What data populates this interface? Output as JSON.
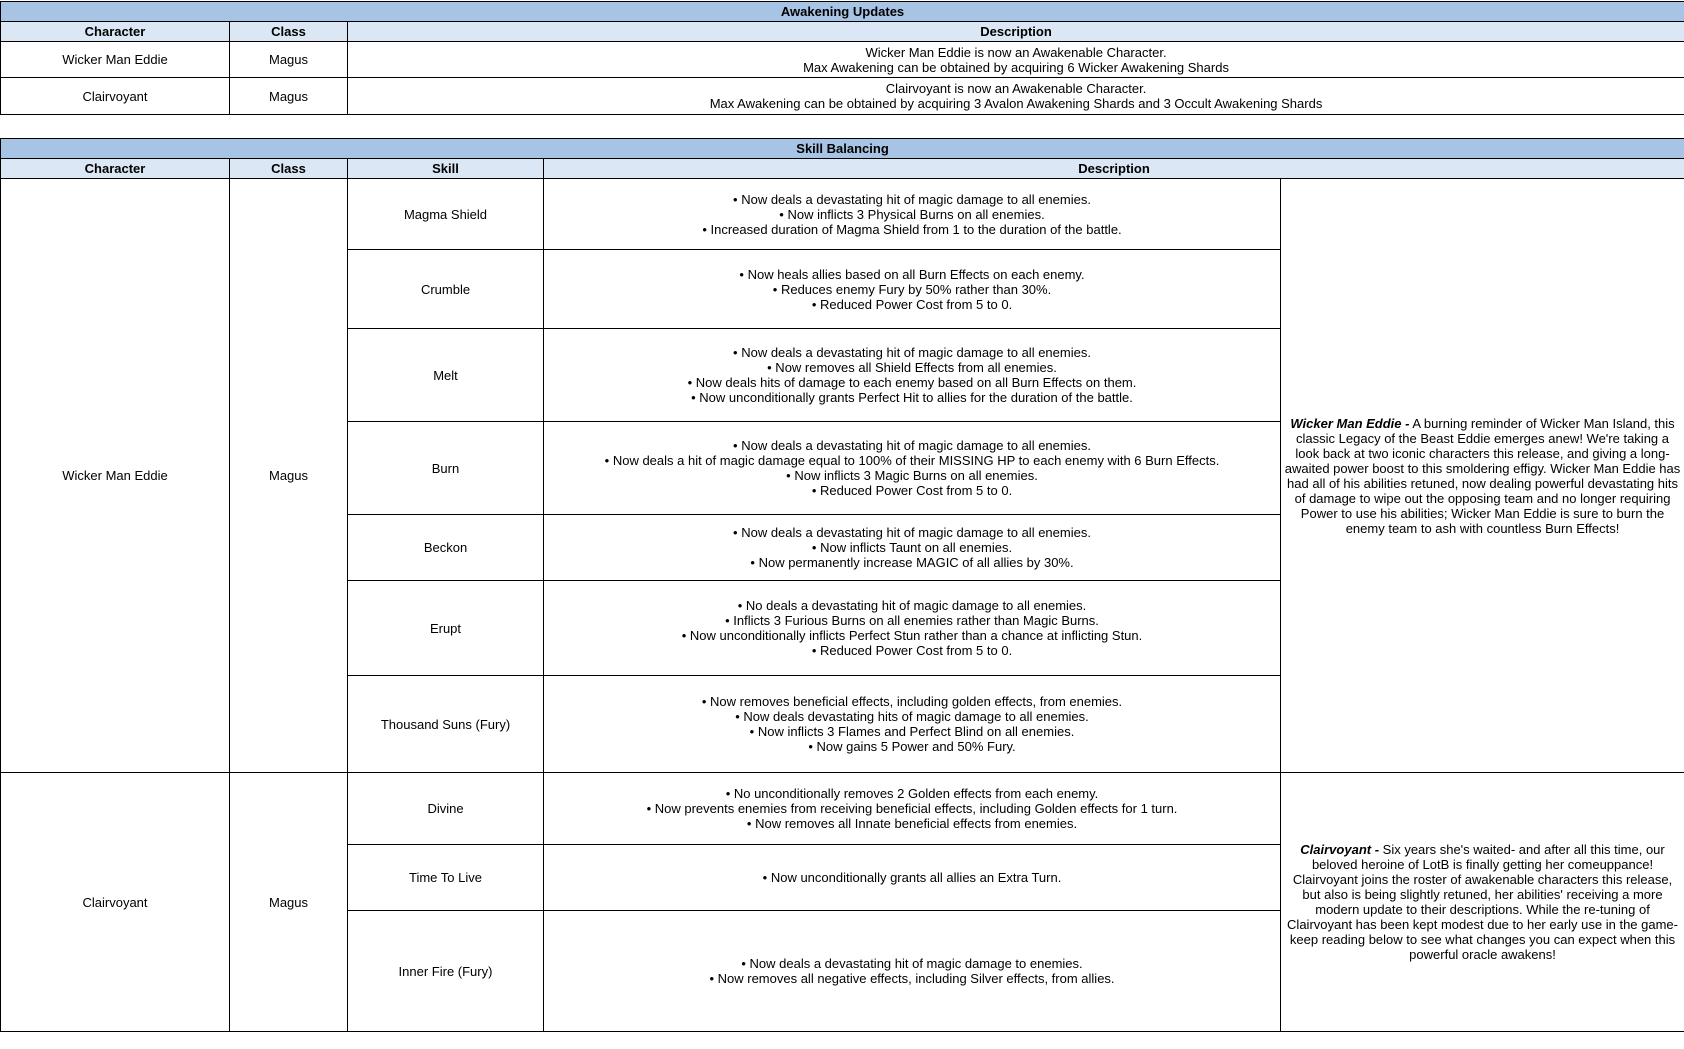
{
  "awakening": {
    "title": "Awakening Updates",
    "headers": [
      "Character",
      "Class",
      "Description"
    ],
    "rows": [
      {
        "character": "Wicker Man Eddie",
        "class": "Magus",
        "desc": [
          "Wicker Man Eddie is now an Awakenable Character.",
          "Max Awakening can be obtained by acquiring 6 Wicker Awakening Shards"
        ]
      },
      {
        "character": "Clairvoyant",
        "class": "Magus",
        "desc": [
          "Clairvoyant is now an Awakenable Character.",
          "Max Awakening can be obtained by acquiring 3 Avalon Awakening Shards and 3 Occult Awakening Shards"
        ]
      }
    ]
  },
  "balancing": {
    "title": "Skill Balancing",
    "headers": [
      "Character",
      "Class",
      "Skill",
      "Description"
    ],
    "groups": [
      {
        "character": "Wicker Man Eddie",
        "class": "Magus",
        "lore_name": "Wicker Man Eddie -",
        "lore_text": " A burning reminder of Wicker Man Island, this classic Legacy of the Beast Eddie emerges anew! We're taking a look back at two iconic characters this release, and giving a long-awaited power boost to this smoldering effigy. Wicker Man Eddie has had all of his abilities retuned, now dealing powerful devastating hits of damage to wipe out the opposing team and no longer requiring Power to use his abilities; Wicker Man Eddie is sure to burn the enemy team to ash with countless Burn Effects!",
        "skills": [
          {
            "name": "Magma Shield",
            "desc": [
              "• Now deals a devastating hit of magic damage to all enemies.",
              "• Now inflicts 3 Physical Burns on all enemies.",
              "• Increased duration of Magma Shield from 1 to the duration of the battle."
            ]
          },
          {
            "name": "Crumble",
            "desc": [
              "• Now heals allies based on all Burn Effects on each enemy.",
              "• Reduces enemy Fury by 50% rather than 30%.",
              "• Reduced Power Cost from 5 to 0."
            ]
          },
          {
            "name": "Melt",
            "desc": [
              "• Now deals a devastating hit of magic damage to all enemies.",
              "• Now removes all Shield Effects from all enemies.",
              "• Now deals hits of damage to each enemy based on all Burn Effects on them.",
              "• Now unconditionally grants Perfect Hit to allies for the duration of the battle."
            ]
          },
          {
            "name": "Burn",
            "desc": [
              "• Now deals a devastating hit of magic damage to all enemies.",
              "• Now deals a hit of magic damage equal to 100% of their MISSING HP to each enemy with 6 Burn Effects.",
              "• Now inflicts 3 Magic Burns on all enemies.",
              "• Reduced Power Cost from 5 to 0."
            ]
          },
          {
            "name": "Beckon",
            "desc": [
              "• Now deals a devastating hit of magic damage to all enemies.",
              "• Now inflicts Taunt on all enemies.",
              "• Now permanently increase MAGIC of all allies by 30%."
            ]
          },
          {
            "name": "Erupt",
            "desc": [
              "• No deals a devastating hit of magic damage to all enemies.",
              "• Inflicts 3 Furious Burns on all enemies rather than Magic Burns.",
              "• Now unconditionally inflicts Perfect Stun rather than a chance at inflicting Stun.",
              "• Reduced Power Cost from 5 to 0."
            ]
          },
          {
            "name": "Thousand Suns (Fury)",
            "desc": [
              "• Now removes beneficial effects, including golden effects, from enemies.",
              "• Now deals devastating hits of magic damage to all enemies.",
              "• Now inflicts 3 Flames and Perfect Blind on all enemies.",
              "• Now gains 5 Power and 50% Fury."
            ]
          }
        ]
      },
      {
        "character": "Clairvoyant",
        "class": "Magus",
        "lore_name": "Clairvoyant -",
        "lore_text": " Six years she's waited- and after all this time, our beloved heroine of LotB is finally getting her comeuppance! Clairvoyant joins the roster of awakenable characters this release, but also is being slightly retuned, her abilities' receiving a more modern update to their descriptions. While the re-tuning of Clairvoyant has been kept modest due to her early use in the game- keep reading below to see what changes you can expect when this powerful oracle awakens!",
        "skills": [
          {
            "name": "Divine",
            "desc": [
              "• No unconditionally removes 2 Golden effects from each enemy.",
              "• Now prevents enemies from receiving beneficial effects, including Golden effects for 1 turn.",
              "• Now removes all Innate beneficial effects from enemies."
            ]
          },
          {
            "name": "Time To Live",
            "desc": [
              "• Now unconditionally grants all allies an Extra Turn."
            ]
          },
          {
            "name": "Inner Fire (Fury)",
            "desc": [
              "• Now deals a devastating hit of magic damage to enemies.",
              "• Now removes all negative effects, including Silver effects, from allies."
            ]
          }
        ]
      }
    ]
  }
}
